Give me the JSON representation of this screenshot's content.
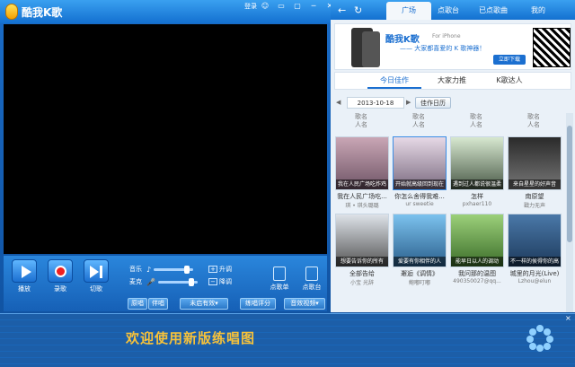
{
  "app": {
    "title": "酷我K歌",
    "login": "登录"
  },
  "window_buttons": [
    "☺",
    "▭",
    "▢",
    "─",
    "✕"
  ],
  "controls": {
    "play_label": "播放",
    "record_label": "录歌",
    "next_label": "切歌",
    "music_label": "音乐",
    "mic_label": "麦克",
    "tone_up": "升调",
    "tone_down": "降调",
    "song_list_label": "点歌单",
    "order_song_label": "点歌台",
    "original_label": "原唱",
    "accompany_label": "伴唱",
    "no_effect_label": "未启有效▾",
    "practice_score_label": "练唱评分",
    "play_video_label": "音效视频▾"
  },
  "right_panel": {
    "tabs": [
      "广场",
      "点歌台",
      "已点歌曲",
      "我的"
    ],
    "active_tab": 0,
    "banner": {
      "brand": "酷我K歌",
      "for": "For iPhone",
      "slogan": "—— 大家都喜爱的 K 歌神器！",
      "download": "立即下载"
    },
    "subtabs": [
      "今日佳作",
      "大家力推",
      "K歌达人"
    ],
    "active_subtab": 0,
    "date": "2013-10-18",
    "calendar_button": "佳作日历",
    "header_rows": [
      {
        "song": "歌名",
        "singer": "人名"
      },
      {
        "song": "歌名",
        "singer": "人名"
      },
      {
        "song": "歌名",
        "singer": "人名"
      },
      {
        "song": "歌名",
        "singer": "人名"
      }
    ],
    "cards": [
      {
        "caption": "我在人民广场吃炸鸡",
        "song": "我在人民广场吃...",
        "singer": "琪 • 琪头璐璐"
      },
      {
        "caption": "开始就高级回到现在",
        "song": "你怎么舍得我难...",
        "singer": "ur sweetie"
      },
      {
        "caption": "遇到过人都说很温柔",
        "song": "怎样",
        "singer": "pxhaer110"
      },
      {
        "caption": "来自星星的好声音",
        "song": "南原望",
        "singer": "戳力无声"
      },
      {
        "caption": "想要告诉你的所有",
        "song": "全部告给",
        "singer": "小宝 光辞"
      },
      {
        "caption": "爱要有你相伴的人",
        "song": "邂逅《调情》",
        "singer": "鲍嘟叮嘟"
      },
      {
        "caption": "能早日以人的调动",
        "song": "我问那的温图",
        "singer": "490350027@qq..."
      },
      {
        "caption": "不一样的侯得你的高",
        "song": "城里的月光(Live)",
        "singer": "Lzhou@elun"
      }
    ]
  },
  "ad_strip": {
    "text": "欢迎使用新版练唱图",
    "close": "×"
  },
  "colors": {
    "accent": "#1b6fd0",
    "record": "#f02020",
    "strip_text": "#f7c23a"
  }
}
